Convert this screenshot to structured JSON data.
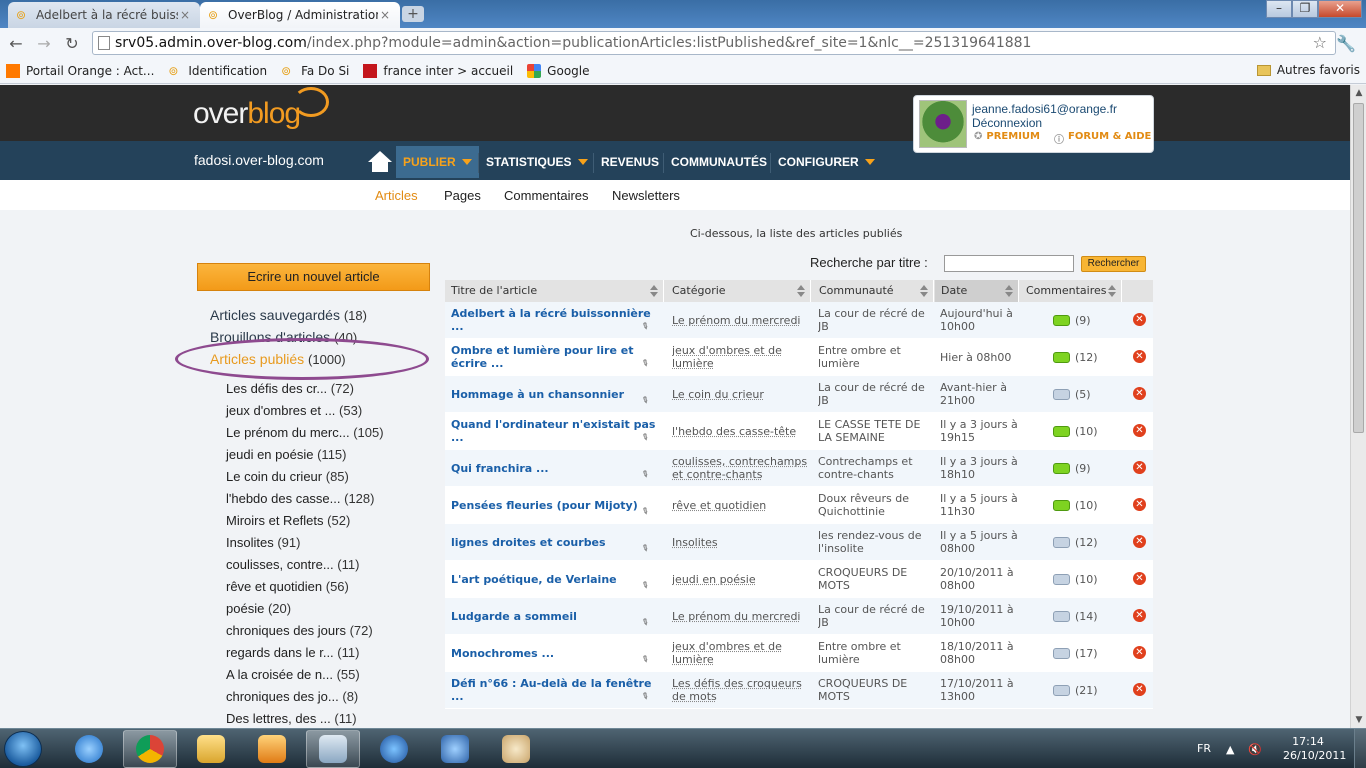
{
  "browser": {
    "tabs": [
      {
        "title": "Adelbert à la récré buissonn",
        "active": false
      },
      {
        "title": "OverBlog / Administration [",
        "active": true
      }
    ],
    "address": {
      "host": "srv05.admin.over-blog.com",
      "path": "/index.php?module=admin&action=publicationArticles:listPublished&ref_site=1&nlc__=251319641881"
    },
    "bookmarks": [
      {
        "label": "Portail Orange : Act...",
        "icon": "orange-square-icon"
      },
      {
        "label": "Identification",
        "icon": "overblog-icon"
      },
      {
        "label": "Fa Do Si",
        "icon": "overblog-icon"
      },
      {
        "label": "france inter > accueil",
        "icon": "franceinter-icon"
      },
      {
        "label": "Google",
        "icon": "google-icon"
      }
    ],
    "other_bookmarks": "Autres favoris"
  },
  "site": {
    "logo_a": "over",
    "logo_b": "blog",
    "name": "fadosi.over-blog.com",
    "menu": [
      {
        "label": "PUBLIER",
        "dropdown": true,
        "active": true
      },
      {
        "label": "STATISTIQUES",
        "dropdown": true,
        "active": false
      },
      {
        "label": "REVENUS",
        "dropdown": false,
        "active": false
      },
      {
        "label": "COMMUNAUTÉS",
        "dropdown": false,
        "active": false
      },
      {
        "label": "CONFIGURER",
        "dropdown": true,
        "active": false
      }
    ],
    "user": {
      "email": "jeanne.fadosi61@orange.fr",
      "logout": "Déconnexion",
      "premium": "PREMIUM",
      "forum": "FORUM & AIDE"
    },
    "subnav": [
      {
        "label": "Articles",
        "active": true
      },
      {
        "label": "Pages",
        "active": false
      },
      {
        "label": "Commentaires",
        "active": false
      },
      {
        "label": "Newsletters",
        "active": false
      }
    ]
  },
  "content": {
    "intro": "Ci-dessous, la liste des articles publiés",
    "search_label": "Recherche par titre :",
    "search_value": "",
    "search_button": "Rechercher",
    "new_article": "Ecrire un nouvel article",
    "sections": [
      {
        "label": "Articles sauvegardés",
        "count": "(18)",
        "active": false
      },
      {
        "label": "Brouillons d'articles",
        "count": "(40)",
        "active": false
      },
      {
        "label": "Articles publiés",
        "count": "(1000)",
        "active": true
      }
    ],
    "categories": [
      {
        "label": "Les défis des cr...",
        "count": "(72)"
      },
      {
        "label": "jeux d'ombres et ...",
        "count": "(53)"
      },
      {
        "label": "Le prénom du merc...",
        "count": "(105)"
      },
      {
        "label": "jeudi en poésie",
        "count": "(115)"
      },
      {
        "label": "Le coin du crieur",
        "count": "(85)"
      },
      {
        "label": "l'hebdo des casse...",
        "count": "(128)"
      },
      {
        "label": "Miroirs et Reflets",
        "count": "(52)"
      },
      {
        "label": "Insolites",
        "count": "(91)"
      },
      {
        "label": "coulisses, contre...",
        "count": "(11)"
      },
      {
        "label": "rêve et quotidien",
        "count": "(56)"
      },
      {
        "label": "poésie",
        "count": "(20)"
      },
      {
        "label": "chroniques des jours",
        "count": "(72)"
      },
      {
        "label": "regards dans le r...",
        "count": "(11)"
      },
      {
        "label": "A la croisée de n...",
        "count": "(55)"
      },
      {
        "label": "chroniques des jo...",
        "count": "(8)"
      },
      {
        "label": "Des lettres, des ...",
        "count": "(11)"
      }
    ],
    "table": {
      "headers": [
        "Titre de l'article",
        "Catégorie",
        "Communauté",
        "Date",
        "Commentaires"
      ],
      "rows": [
        {
          "title": "Adelbert à la récré buissonnière ...",
          "category": "Le prénom du mercredi",
          "community": "La cour de récré de JB",
          "date": "Aujourd'hui à 10h00",
          "comments": "(9)",
          "bubble": "green"
        },
        {
          "title": "Ombre et lumière pour lire et écrire ...",
          "category": "jeux d'ombres et de lumière",
          "community": "Entre ombre et lumière",
          "date": "Hier à 08h00",
          "comments": "(12)",
          "bubble": "green"
        },
        {
          "title": "Hommage à un chansonnier",
          "category": "Le coin du crieur",
          "community": "La cour de récré de JB",
          "date": "Avant-hier à 21h00",
          "comments": "(5)",
          "bubble": "gray"
        },
        {
          "title": "Quand l'ordinateur n'existait pas ...",
          "category": "l'hebdo des casse-tête",
          "community": "LE CASSE TETE DE LA SEMAINE",
          "date": "Il y a 3 jours à 19h15",
          "comments": "(10)",
          "bubble": "green"
        },
        {
          "title": "Qui franchira ...",
          "category": "coulisses, contrechamps et contre-chants",
          "community": "Contrechamps et contre-chants",
          "date": "Il y a 3 jours à 18h10",
          "comments": "(9)",
          "bubble": "green"
        },
        {
          "title": "Pensées fleuries (pour Mijoty)",
          "category": "rêve et quotidien",
          "community": "Doux rêveurs de Quichottinie",
          "date": "Il y a 5 jours à 11h30",
          "comments": "(10)",
          "bubble": "green"
        },
        {
          "title": "lignes droites et courbes",
          "category": "Insolites",
          "community": "les rendez-vous de l'insolite",
          "date": "Il y a 5 jours à 08h00",
          "comments": "(12)",
          "bubble": "gray"
        },
        {
          "title": "L'art poétique, de Verlaine",
          "category": "jeudi en poésie",
          "community": "CROQUEURS DE MOTS",
          "date": "20/10/2011 à 08h00",
          "comments": "(10)",
          "bubble": "gray"
        },
        {
          "title": "Ludgarde a sommeil",
          "category": "Le prénom du mercredi",
          "community": "La cour de récré de JB",
          "date": "19/10/2011 à 10h00",
          "comments": "(14)",
          "bubble": "gray"
        },
        {
          "title": "Monochromes ...",
          "category": "jeux d'ombres et de lumière",
          "community": "Entre ombre et lumière",
          "date": "18/10/2011 à 08h00",
          "comments": "(17)",
          "bubble": "gray"
        },
        {
          "title": "Défi n°66 : Au-delà de la fenêtre ...",
          "category": "Les défis des croqueurs de mots",
          "community": "CROQUEURS DE MOTS",
          "date": "17/10/2011 à 13h00",
          "comments": "(21)",
          "bubble": "gray"
        }
      ]
    }
  },
  "taskbar": {
    "language": "FR",
    "time": "17:14",
    "date": "26/10/2011",
    "apps": [
      "ie-icon",
      "chrome-icon",
      "explorer-icon",
      "media-player-icon",
      "photo-viewer-icon",
      "itunes-icon",
      "thunderbird-icon",
      "paint-icon"
    ]
  },
  "colors": {
    "accent": "#f29b21",
    "nav": "#24425a",
    "link": "#1a5fa8",
    "ellipse": "#8e4a8f"
  }
}
